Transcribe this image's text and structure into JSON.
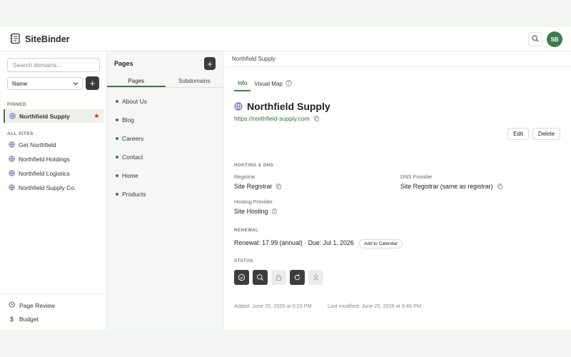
{
  "app": {
    "name": "SiteBinder",
    "user_initials": "SB"
  },
  "sidebar": {
    "search_placeholder": "Search domains...",
    "sort_value": "Name",
    "add_label": "+",
    "pinned_label": "PINNED",
    "pinned": [
      {
        "label": "Northfield Supply",
        "starred": true
      }
    ],
    "all_label": "ALL SITES",
    "sites": [
      {
        "label": "Get Northfield"
      },
      {
        "label": "Northfield Holdings"
      },
      {
        "label": "Northfield Logistics"
      },
      {
        "label": "Northfield Supply Co."
      }
    ],
    "footer": [
      {
        "label": "Page Review",
        "icon": "clock-icon"
      },
      {
        "label": "Budget",
        "icon": "dollar-icon"
      }
    ]
  },
  "pages_panel": {
    "title": "Pages",
    "add_label": "+",
    "tabs": [
      {
        "label": "Pages",
        "active": true
      },
      {
        "label": "Subdomains",
        "active": false
      }
    ],
    "items": [
      "About Us",
      "Blog",
      "Careers",
      "Contact",
      "Home",
      "Products"
    ]
  },
  "main": {
    "breadcrumb": "Northfield Supply",
    "tabs": [
      {
        "label": "Info",
        "active": true
      },
      {
        "label": "Visual Map",
        "active": false
      }
    ],
    "title": "Northfield Supply",
    "url": "https://northfield-supply.com",
    "edit_label": "Edit",
    "delete_label": "Delete",
    "hosting": {
      "header": "HOSTING & DNS",
      "registrar_label": "Registrar",
      "registrar_value": "Site Registrar",
      "dns_label": "DNS Provider",
      "dns_value": "Site Registrar (same as registrar)",
      "hosting_label": "Hosting Provider",
      "hosting_value": "Site Hosting"
    },
    "renewal": {
      "header": "RENEWAL",
      "text": "Renewal: 17.99 (annual) · Due: Jul 1, 2026",
      "calendar_label": "Add to Calendar"
    },
    "status": {
      "header": "STATUS",
      "icons": [
        {
          "name": "check-circle-icon",
          "active": true
        },
        {
          "name": "search-icon",
          "active": true
        },
        {
          "name": "lock-icon",
          "active": false
        },
        {
          "name": "refresh-icon",
          "active": true
        },
        {
          "name": "user-icon",
          "active": false
        }
      ]
    },
    "added": "Added: June 25, 2026 at 9:23 PM",
    "modified": "Last modified: June 25, 2026 at 9:46 PM"
  },
  "colors": {
    "accent": "#3f7a4a",
    "link": "#2f6e3b",
    "star": "#c0392b"
  }
}
